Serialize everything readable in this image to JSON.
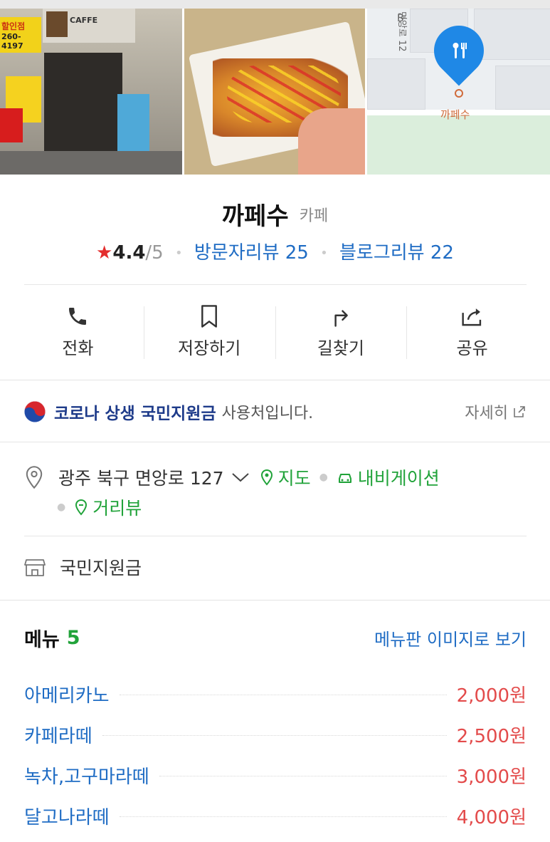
{
  "photos": {
    "storefront_sign": "할인점",
    "storefront_phone": "260-4197",
    "storefront_cafe": "CAFFE",
    "map_label": "까페수",
    "map_street": "면앙로 12"
  },
  "place": {
    "name": "까페수",
    "category": "카페",
    "rating": "4.4",
    "rating_max": "/5",
    "visitor_reviews": "방문자리뷰 25",
    "blog_reviews": "블로그리뷰 22"
  },
  "actions": [
    {
      "label": "전화",
      "icon": "phone-icon"
    },
    {
      "label": "저장하기",
      "icon": "bookmark-icon"
    },
    {
      "label": "길찾기",
      "icon": "directions-icon"
    },
    {
      "label": "공유",
      "icon": "share-icon"
    }
  ],
  "support": {
    "strong": "코로나 상생 국민지원금",
    "rest": "사용처입니다.",
    "detail": "자세히"
  },
  "address": {
    "text": "광주 북구 면앙로 127",
    "map": "지도",
    "navigation": "내비게이션",
    "street_view": "거리뷰"
  },
  "facility": {
    "text": "국민지원금"
  },
  "menu": {
    "title": "메뉴",
    "count": "5",
    "board_link": "메뉴판 이미지로 보기",
    "items": [
      {
        "name": "아메리카노",
        "price": "2,000원"
      },
      {
        "name": "카페라떼",
        "price": "2,500원"
      },
      {
        "name": "녹차,고구마라떼",
        "price": "3,000원"
      },
      {
        "name": "달고나라떼",
        "price": "4,000원"
      }
    ]
  },
  "colors": {
    "accent_blue": "#1f6cc4",
    "accent_green": "#21a33a",
    "price_red": "#e34b4b",
    "star_red": "#e32d2d"
  }
}
